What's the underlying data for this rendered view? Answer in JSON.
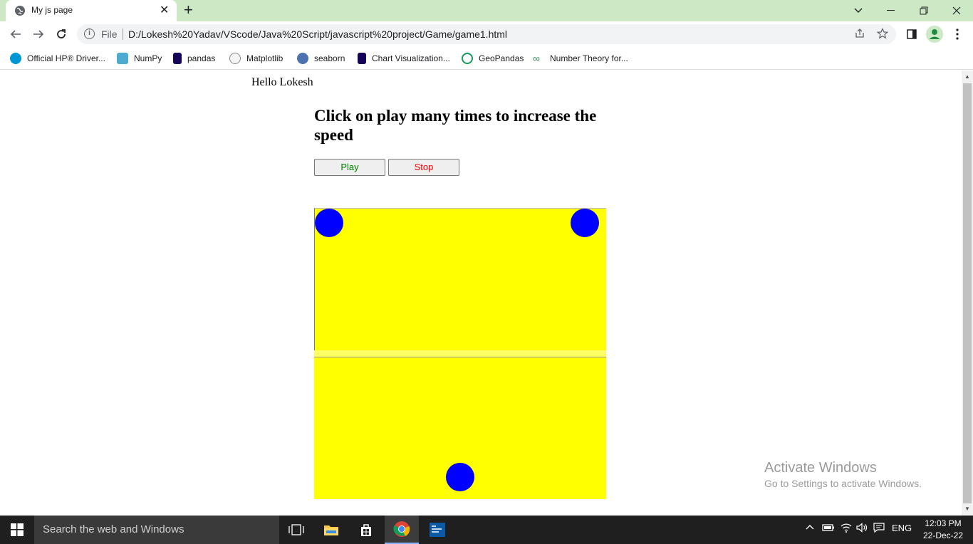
{
  "browser": {
    "tab_title": "My js page",
    "tab_close": "✕",
    "new_tab": "+",
    "file_label": "File",
    "url": "D:/Lokesh%20Yadav/VScode/Java%20Script/javascript%20project/Game/game1.html"
  },
  "bookmarks": [
    {
      "label": "Official HP® Driver...",
      "color": "#0096d6"
    },
    {
      "label": "NumPy",
      "color": "#4dabcf"
    },
    {
      "label": "pandas",
      "color": "#150458"
    },
    {
      "label": "Matplotlib",
      "color": "#888888"
    },
    {
      "label": "seaborn",
      "color": "#4c72b0"
    },
    {
      "label": "Chart Visualization...",
      "color": "#150458"
    },
    {
      "label": "GeoPandas",
      "color": "#139c5a"
    },
    {
      "label": "Number Theory for...",
      "color": "#2e8b57"
    }
  ],
  "page": {
    "greeting": "Hello Lokesh",
    "heading": "Click on play many times to increase the speed",
    "play_label": "Play",
    "stop_label": "Stop",
    "canvas_color": "#ffff00",
    "ball_color": "#0000ff"
  },
  "watermark": {
    "line1": "Activate Windows",
    "line2": "Go to Settings to activate Windows."
  },
  "taskbar": {
    "search_placeholder": "Search the web and Windows",
    "language": "ENG",
    "time": "12:03 PM",
    "date": "22-Dec-22"
  }
}
